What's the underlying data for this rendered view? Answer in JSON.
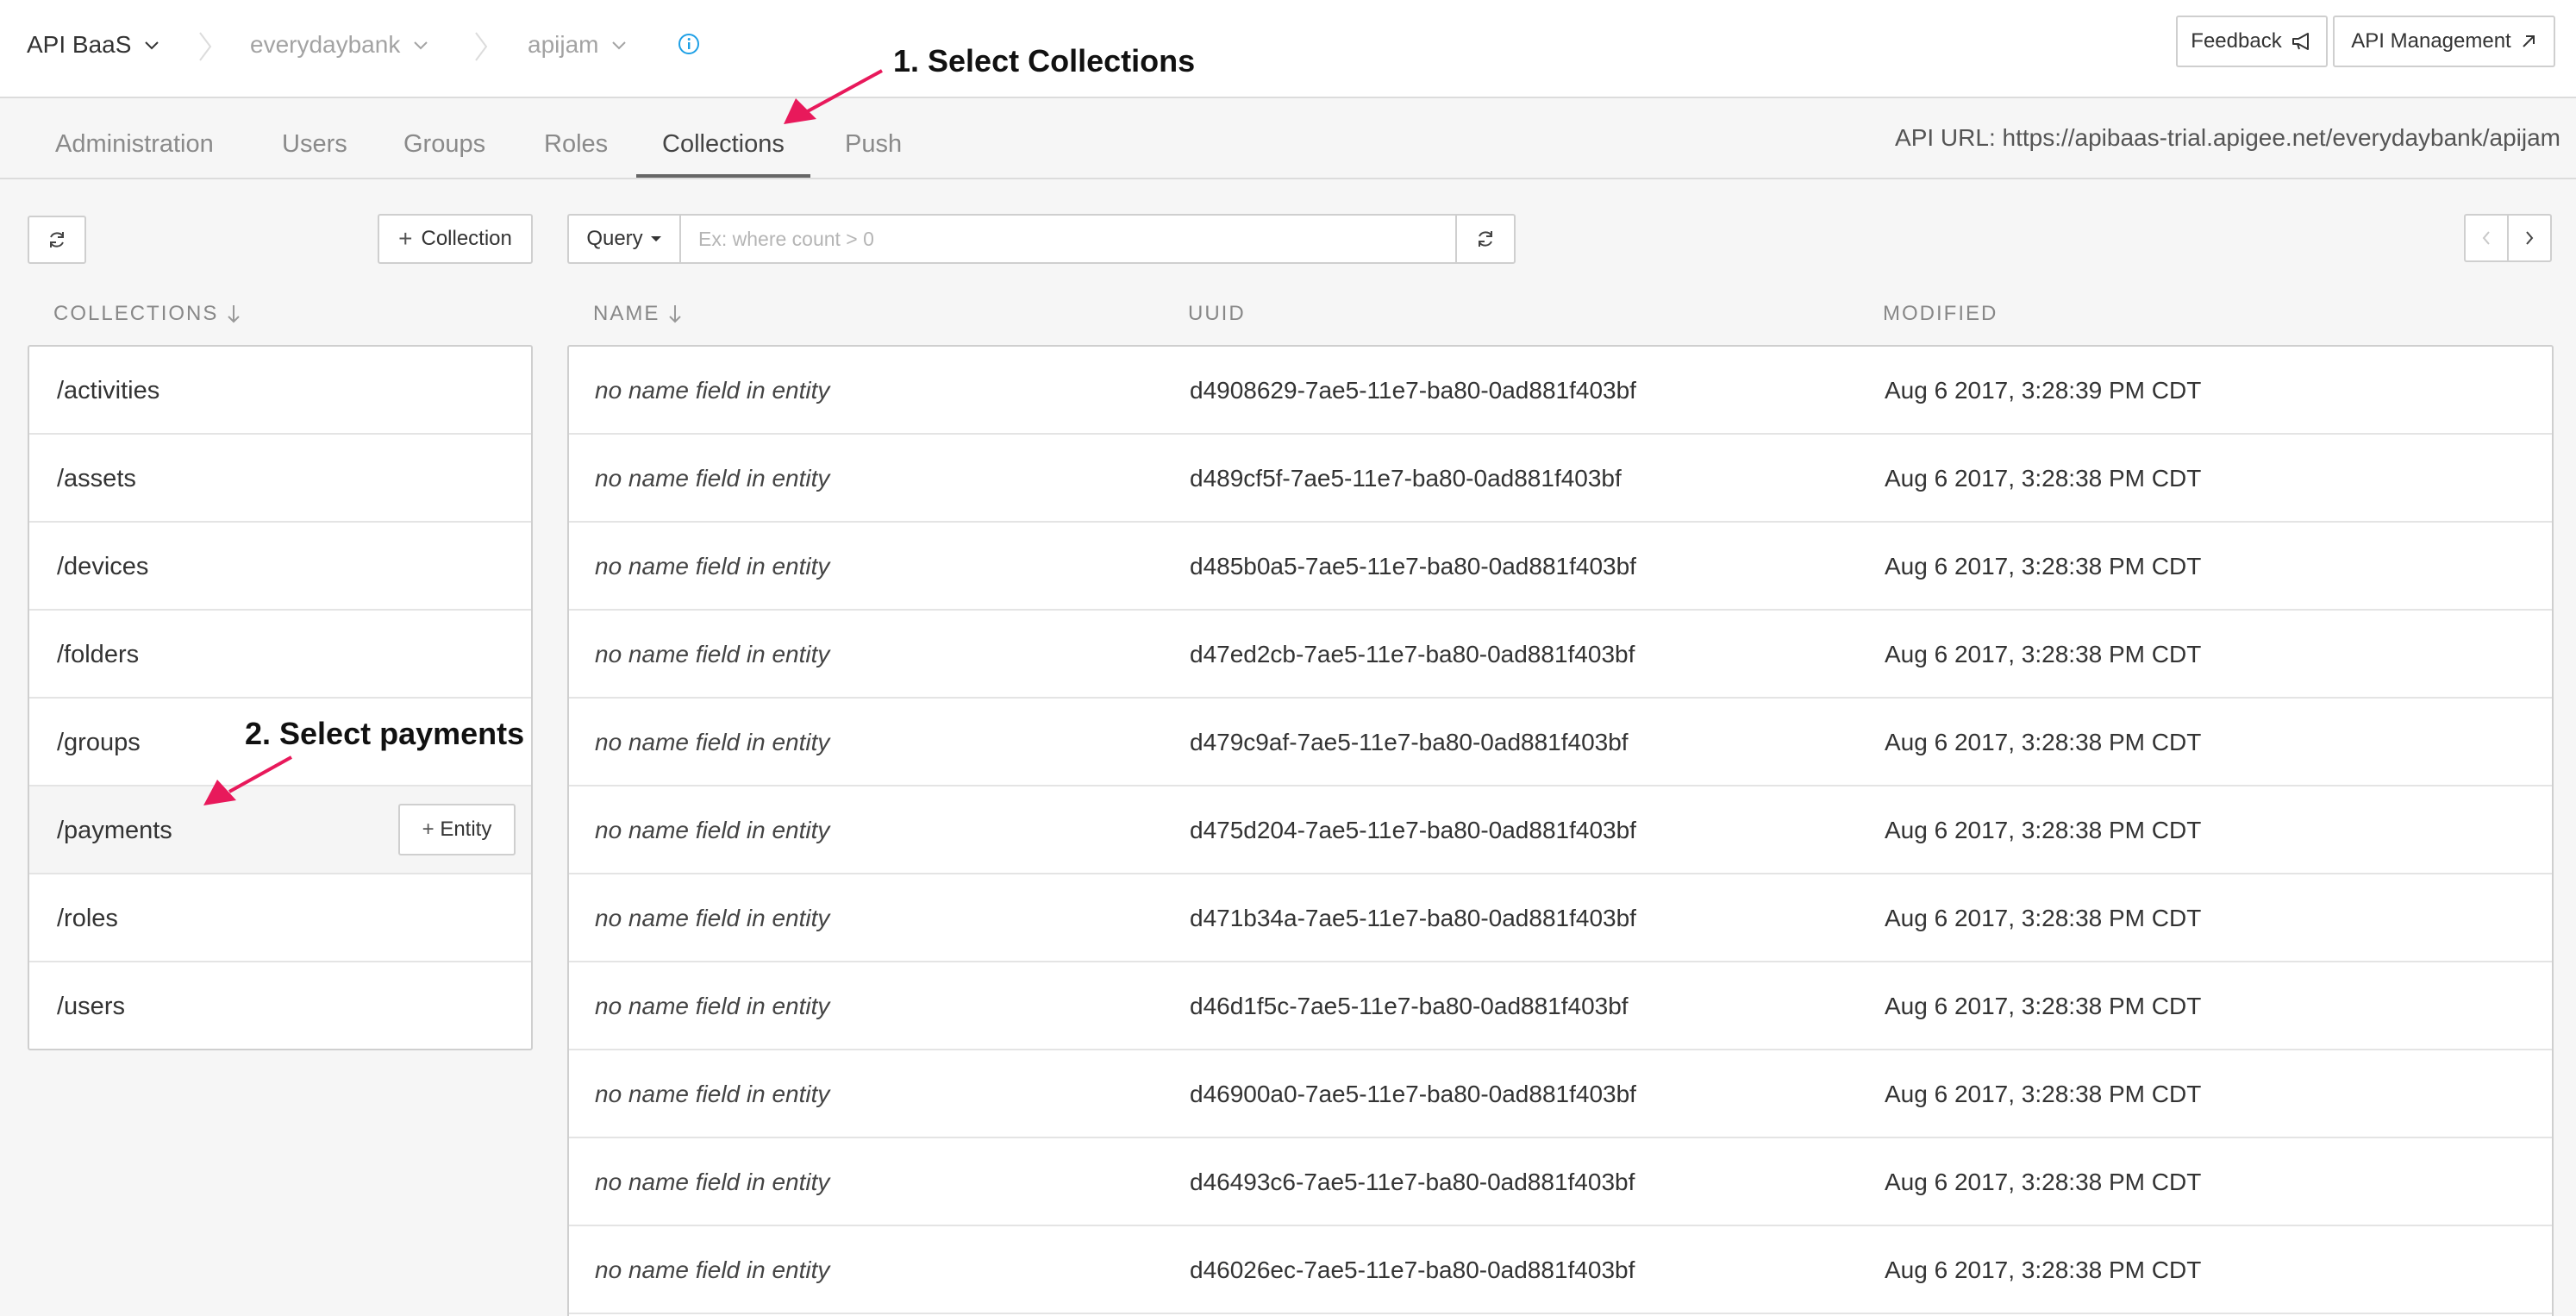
{
  "header": {
    "app_name": "API BaaS",
    "org_name": "everydaybank",
    "app_instance": "apijam",
    "feedback_label": "Feedback",
    "api_management_label": "API Management"
  },
  "tabs": [
    {
      "label": "Administration",
      "active": false
    },
    {
      "label": "Users",
      "active": false
    },
    {
      "label": "Groups",
      "active": false
    },
    {
      "label": "Roles",
      "active": false
    },
    {
      "label": "Collections",
      "active": true
    },
    {
      "label": "Push",
      "active": false
    }
  ],
  "api_url": "API URL: https://apibaas-trial.apigee.net/everydaybank/apijam",
  "toolbar": {
    "add_collection_label": "Collection",
    "query_label": "Query",
    "query_placeholder": "Ex: where count > 0"
  },
  "collections": {
    "header": "COLLECTIONS",
    "items": [
      {
        "label": "/activities"
      },
      {
        "label": "/assets"
      },
      {
        "label": "/devices"
      },
      {
        "label": "/folders"
      },
      {
        "label": "/groups"
      },
      {
        "label": "/payments",
        "selected": true
      },
      {
        "label": "/roles"
      },
      {
        "label": "/users"
      }
    ],
    "entity_button_label": "Entity"
  },
  "table": {
    "columns": [
      "NAME",
      "UUID",
      "MODIFIED"
    ],
    "rows": [
      {
        "name": "no name field in entity",
        "uuid": "d4908629-7ae5-11e7-ba80-0ad881f403bf",
        "modified": "Aug 6 2017, 3:28:39 PM CDT"
      },
      {
        "name": "no name field in entity",
        "uuid": "d489cf5f-7ae5-11e7-ba80-0ad881f403bf",
        "modified": "Aug 6 2017, 3:28:38 PM CDT"
      },
      {
        "name": "no name field in entity",
        "uuid": "d485b0a5-7ae5-11e7-ba80-0ad881f403bf",
        "modified": "Aug 6 2017, 3:28:38 PM CDT"
      },
      {
        "name": "no name field in entity",
        "uuid": "d47ed2cb-7ae5-11e7-ba80-0ad881f403bf",
        "modified": "Aug 6 2017, 3:28:38 PM CDT"
      },
      {
        "name": "no name field in entity",
        "uuid": "d479c9af-7ae5-11e7-ba80-0ad881f403bf",
        "modified": "Aug 6 2017, 3:28:38 PM CDT"
      },
      {
        "name": "no name field in entity",
        "uuid": "d475d204-7ae5-11e7-ba80-0ad881f403bf",
        "modified": "Aug 6 2017, 3:28:38 PM CDT"
      },
      {
        "name": "no name field in entity",
        "uuid": "d471b34a-7ae5-11e7-ba80-0ad881f403bf",
        "modified": "Aug 6 2017, 3:28:38 PM CDT"
      },
      {
        "name": "no name field in entity",
        "uuid": "d46d1f5c-7ae5-11e7-ba80-0ad881f403bf",
        "modified": "Aug 6 2017, 3:28:38 PM CDT"
      },
      {
        "name": "no name field in entity",
        "uuid": "d46900a0-7ae5-11e7-ba80-0ad881f403bf",
        "modified": "Aug 6 2017, 3:28:38 PM CDT"
      },
      {
        "name": "no name field in entity",
        "uuid": "d46493c6-7ae5-11e7-ba80-0ad881f403bf",
        "modified": "Aug 6 2017, 3:28:38 PM CDT"
      },
      {
        "name": "no name field in entity",
        "uuid": "d46026ec-7ae5-11e7-ba80-0ad881f403bf",
        "modified": "Aug 6 2017, 3:28:38 PM CDT"
      }
    ]
  },
  "annotations": {
    "step1": "1. Select Collections",
    "step2": "2. Select payments"
  },
  "colors": {
    "annotation_arrow": "#e8195b",
    "info_icon": "#1ea0e6",
    "active_tab_underline": "#666666"
  }
}
